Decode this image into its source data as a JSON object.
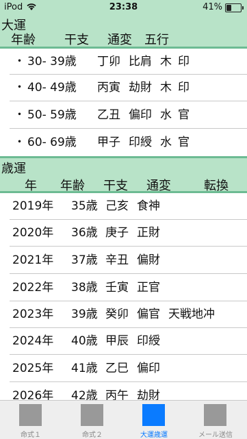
{
  "status": {
    "carrier": "iPod",
    "time": "23:38",
    "battery": "41%",
    "battery_level": 0.41
  },
  "taiun": {
    "title": "大運",
    "columns": [
      "年齢",
      "干支",
      "通変",
      "五行"
    ],
    "rows": [
      {
        "bullet": "・",
        "age": "30- 39歳",
        "kanshi": "丁卯",
        "tsuhen": "比肩",
        "gogyo1": "木",
        "gogyo2": "印"
      },
      {
        "bullet": "・",
        "age": "40- 49歳",
        "kanshi": "丙寅",
        "tsuhen": "劫財",
        "gogyo1": "木",
        "gogyo2": "印"
      },
      {
        "bullet": "・",
        "age": "50- 59歳",
        "kanshi": "乙丑",
        "tsuhen": "偏印",
        "gogyo1": "水",
        "gogyo2": "官"
      },
      {
        "bullet": "・",
        "age": "60- 69歳",
        "kanshi": "甲子",
        "tsuhen": "印綬",
        "gogyo1": "水",
        "gogyo2": "官"
      }
    ]
  },
  "saiun": {
    "title": "歳運",
    "columns": [
      "年",
      "年齢",
      "干支",
      "通変",
      "転換"
    ],
    "rows": [
      {
        "year": "2019年",
        "age": "35歳",
        "kanshi": "己亥",
        "tsuhen": "食神",
        "tenkan": ""
      },
      {
        "year": "2020年",
        "age": "36歳",
        "kanshi": "庚子",
        "tsuhen": "正財",
        "tenkan": ""
      },
      {
        "year": "2021年",
        "age": "37歳",
        "kanshi": "辛丑",
        "tsuhen": "偏財",
        "tenkan": ""
      },
      {
        "year": "2022年",
        "age": "38歳",
        "kanshi": "壬寅",
        "tsuhen": "正官",
        "tenkan": ""
      },
      {
        "year": "2023年",
        "age": "39歳",
        "kanshi": "癸卯",
        "tsuhen": "偏官",
        "tenkan": "天戦地冲"
      },
      {
        "year": "2024年",
        "age": "40歳",
        "kanshi": "甲辰",
        "tsuhen": "印綬",
        "tenkan": ""
      },
      {
        "year": "2025年",
        "age": "41歳",
        "kanshi": "乙巳",
        "tsuhen": "偏印",
        "tenkan": ""
      },
      {
        "year": "2026年",
        "age": "42歳",
        "kanshi": "丙午",
        "tsuhen": "劫財",
        "tenkan": ""
      }
    ]
  },
  "tabs": [
    {
      "label": "命式１",
      "active": false
    },
    {
      "label": "命式２",
      "active": false
    },
    {
      "label": "大運歳運",
      "active": true
    },
    {
      "label": "メール送信",
      "active": false
    }
  ],
  "colors": {
    "header_bg": "#b8e3c8",
    "divider": "#6dbb93",
    "active_tab": "#0a7bff",
    "inactive_tab": "#999999"
  }
}
